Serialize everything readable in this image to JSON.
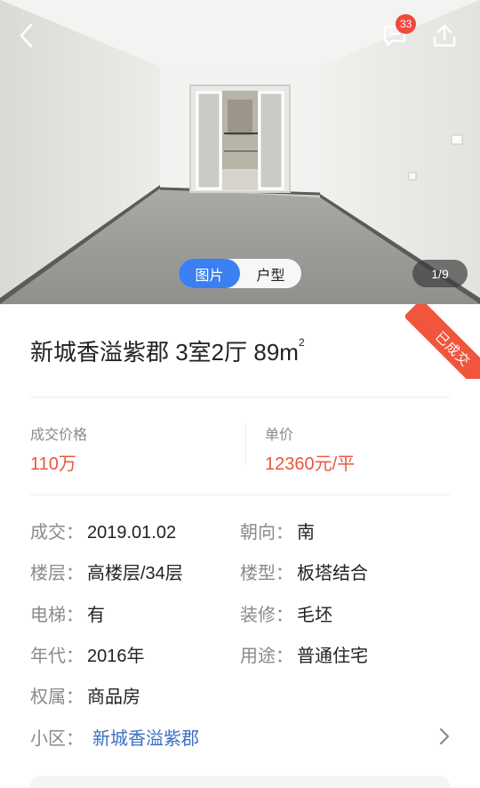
{
  "header": {
    "message_badge_count": "33",
    "gallery_tabs": [
      {
        "label": "图片",
        "active": true
      },
      {
        "label": "户型",
        "active": false
      }
    ],
    "photo_counter": "1/9"
  },
  "status_ribbon": "已成交",
  "listing": {
    "title": "新城香溢紫郡 3室2厅 89m",
    "title_sup": "2"
  },
  "price": {
    "deal_label": "成交价格",
    "deal_value": "110万",
    "unit_label": "单价",
    "unit_value": "12360元/平"
  },
  "details": {
    "deal_date_label": "成交：",
    "deal_date": "2019.01.02",
    "orientation_label": "朝向：",
    "orientation": "南",
    "floor_label": "楼层：",
    "floor": "高楼层/34层",
    "building_type_label": "楼型：",
    "building_type": "板塔结合",
    "elevator_label": "电梯：",
    "elevator": "有",
    "decoration_label": "装修：",
    "decoration": "毛坯",
    "year_label": "年代：",
    "year": "2016年",
    "usage_label": "用途：",
    "usage": "普通住宅",
    "ownership_label": "权属：",
    "ownership": "商品房",
    "community_label": "小区：",
    "community": "新城香溢紫郡"
  },
  "colors": {
    "accent_blue": "#3b7ff0",
    "price_red": "#e8573d",
    "ribbon": "#f0553e",
    "badge": "#f04a3e",
    "link": "#3b6fc4"
  },
  "icons": [
    "back-arrow-icon",
    "message-icon",
    "share-icon",
    "chevron-right-icon"
  ]
}
